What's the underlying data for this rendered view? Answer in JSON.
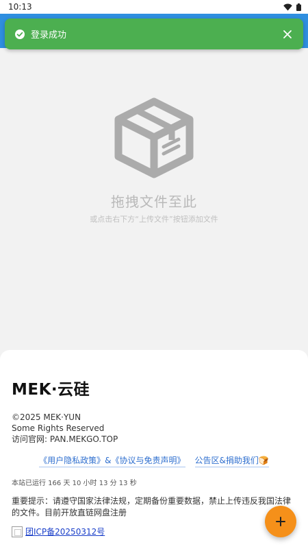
{
  "status_bar": {
    "time": "10:13"
  },
  "toast": {
    "message": "登录成功",
    "color": "#4caf50"
  },
  "drop_area": {
    "title": "拖拽文件至此",
    "subtitle": "或点击右下方“上传文件”按钮添加文件",
    "icon": "package-box-icon"
  },
  "footer": {
    "brand": "MEK·云硅",
    "copyright": "©2025 MEK·YUN",
    "rights": "Some Rights Reserved",
    "website": "访问官网: PAN.MEKGO.TOP",
    "links": {
      "privacy": "《用户隐私政策》&《协议与免责声明》",
      "announcement": "公告区&捐助我们🍞"
    },
    "runtime": "本站已运行 166 天 10 小时 13 分 13 秒",
    "notice": "重要提示：请遵守国家法律法规，定期备份重要数据，禁止上传违反我国法律的文件。目前开放直链网盘注册",
    "icp": "团ICP备20250312号"
  },
  "colors": {
    "header": "#2f8fe0",
    "fab": "#f5901a",
    "link": "#2f6fcf"
  }
}
